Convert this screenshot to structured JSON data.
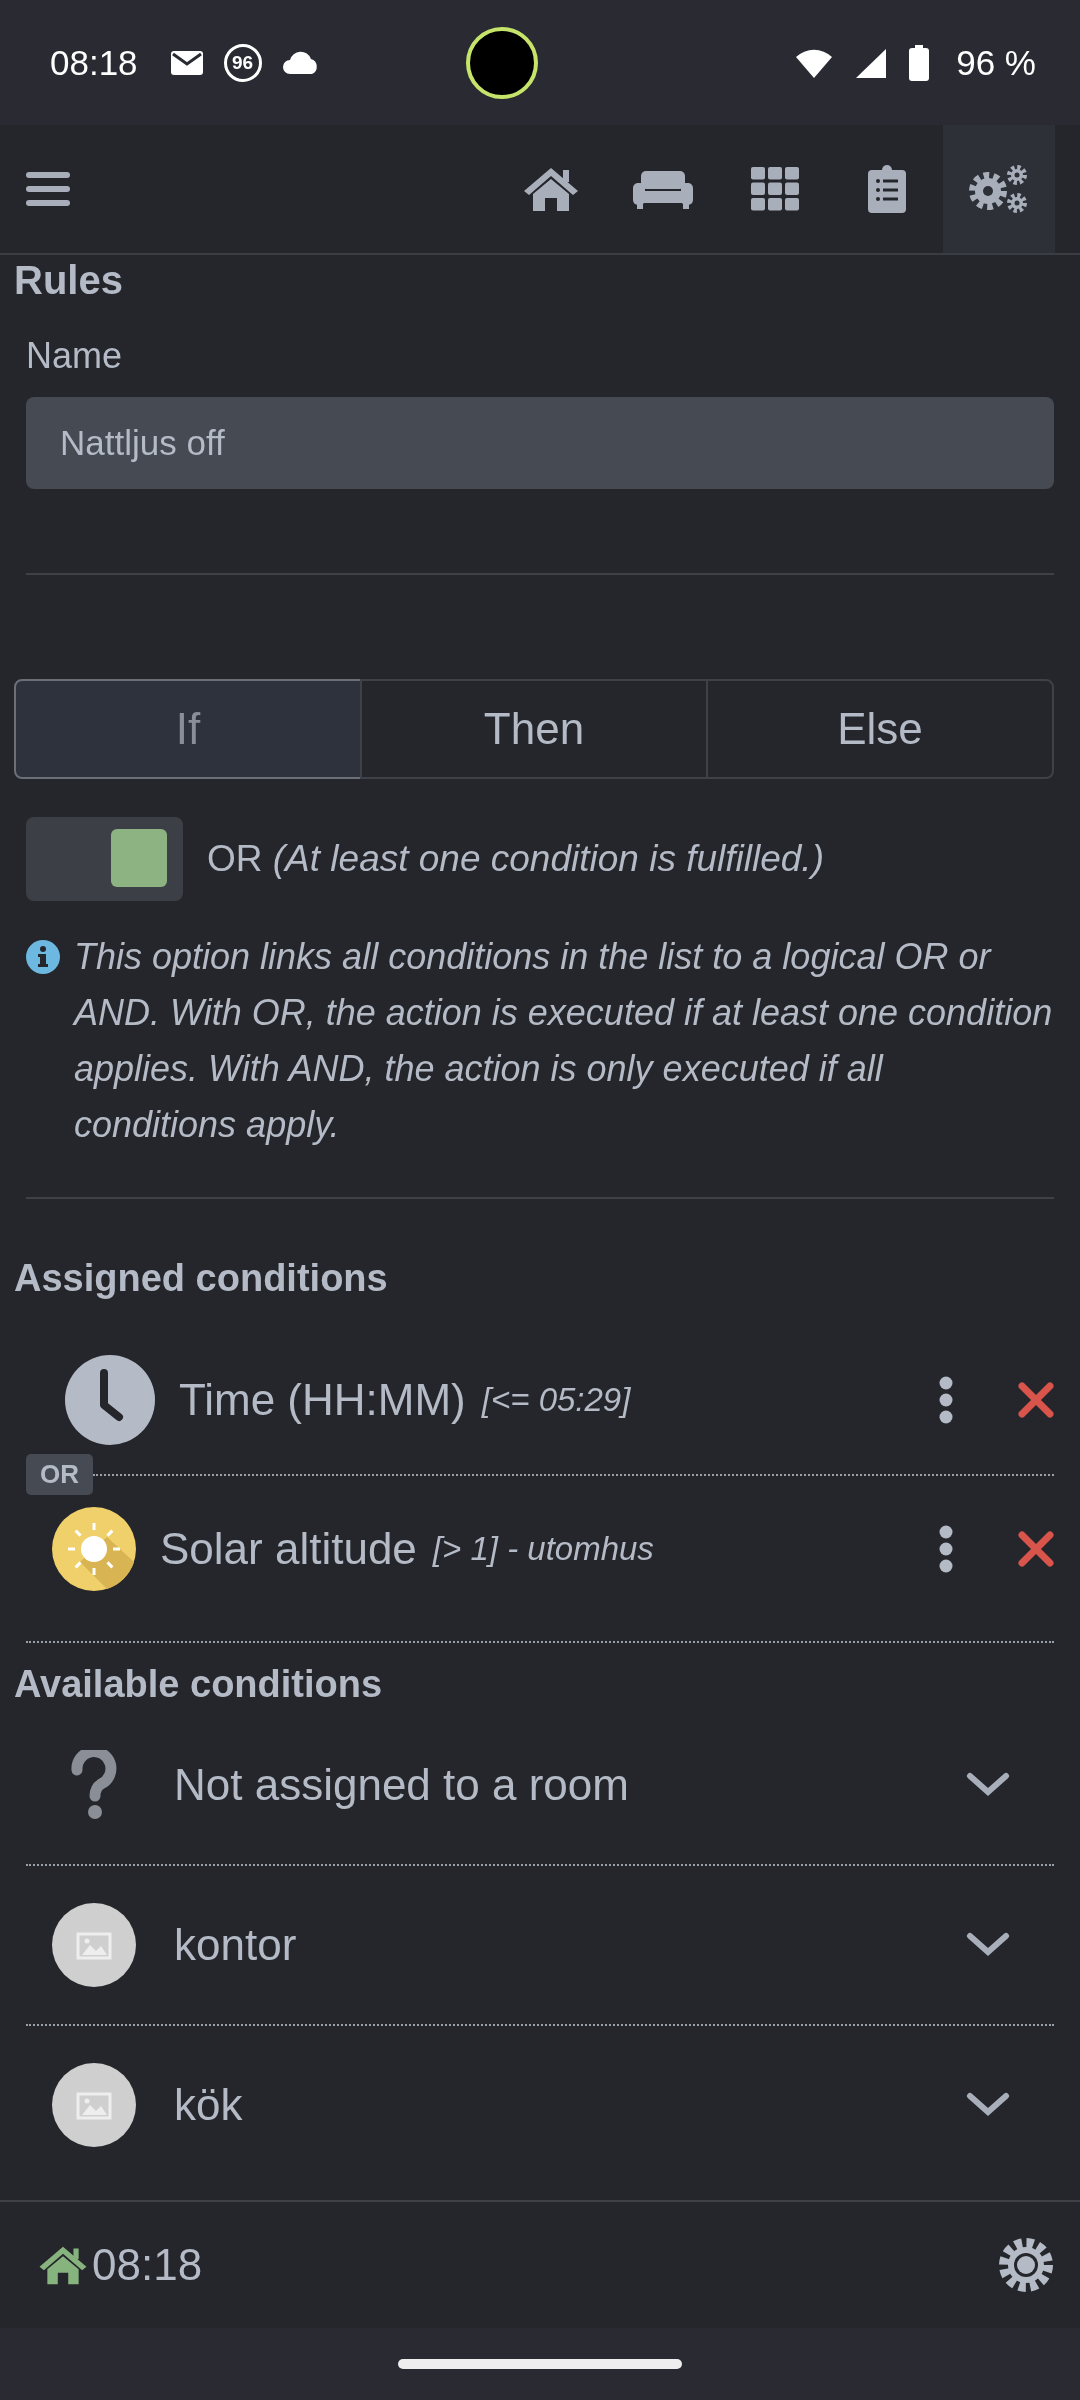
{
  "status_bar": {
    "time": "08:18",
    "badge": "96",
    "battery": "96 %"
  },
  "nav": [
    {
      "kind": "home",
      "selected": false
    },
    {
      "kind": "sofa",
      "selected": false
    },
    {
      "kind": "grid",
      "selected": false
    },
    {
      "kind": "clipboard",
      "selected": false
    },
    {
      "kind": "gears",
      "selected": true
    }
  ],
  "page_title": "Rules",
  "name_field": {
    "label": "Name",
    "value": "Nattljus off"
  },
  "tabs": [
    {
      "label": "If",
      "selected": true
    },
    {
      "label": "Then",
      "selected": false
    },
    {
      "label": "Else",
      "selected": false
    }
  ],
  "logic_toggle": {
    "on": true,
    "label": "OR",
    "note": "(At least one condition is fulfilled.)"
  },
  "info": "This option links all conditions in the list to a logical OR or AND. With OR, the action is executed if at least one condition applies. With AND, the action is only executed if all conditions apply.",
  "assigned": {
    "title": "Assigned conditions",
    "connector": "OR",
    "items": [
      {
        "kind": "clock",
        "name": "Time (HH:MM)",
        "detail": "[<= 05:29]"
      },
      {
        "kind": "sun",
        "name": "Solar altitude",
        "detail": "[> 1]  - utomhus"
      }
    ]
  },
  "available": {
    "title": "Available conditions",
    "items": [
      {
        "kind": "unknown",
        "name": "Not assigned to a room",
        "expanded": false
      },
      {
        "kind": "room",
        "name": "kontor",
        "expanded": false
      },
      {
        "kind": "room",
        "name": "kök",
        "expanded": false
      }
    ]
  },
  "footer": {
    "time": "08:18"
  }
}
